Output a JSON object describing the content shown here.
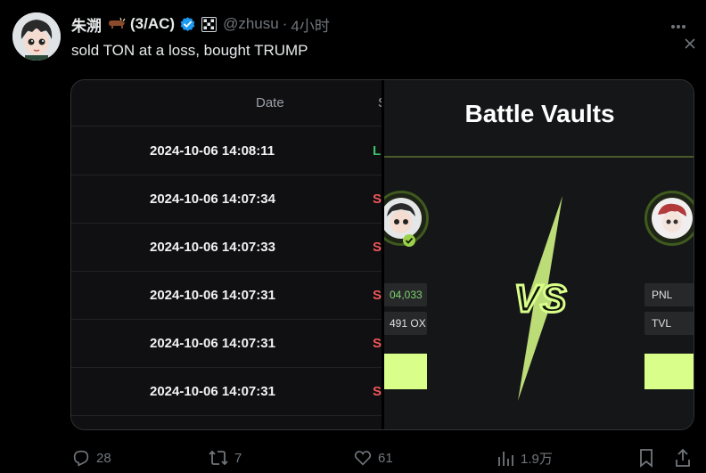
{
  "tweet": {
    "display_name": "朱溯",
    "name_suffix": "(3/AC)",
    "handle": "@zhusu",
    "dot": "·",
    "time": "4小时",
    "text": "sold TON at a loss, bought TRUMP"
  },
  "media": {
    "left": {
      "column_header": "Date",
      "column_header_2": "S",
      "rows": [
        {
          "date": "2024-10-06 14:08:11",
          "side": "L",
          "side_color": "#3fbf6a"
        },
        {
          "date": "2024-10-06 14:07:34",
          "side": "S",
          "side_color": "#f2555a"
        },
        {
          "date": "2024-10-06 14:07:33",
          "side": "S",
          "side_color": "#f2555a"
        },
        {
          "date": "2024-10-06 14:07:31",
          "side": "S",
          "side_color": "#f2555a"
        },
        {
          "date": "2024-10-06 14:07:31",
          "side": "S",
          "side_color": "#f2555a"
        },
        {
          "date": "2024-10-06 14:07:31",
          "side": "S",
          "side_color": "#f2555a"
        }
      ]
    },
    "right": {
      "title": "Battle Vaults",
      "left_pnl": "04,033",
      "left_tvl": "491 OX",
      "right_pnl_label": "PNL",
      "right_tvl_label": "TVL",
      "vs": "VS",
      "accent_color": "#d9ff8a"
    }
  },
  "actions": {
    "replies": "28",
    "reposts": "7",
    "likes": "61",
    "views": "1.9万"
  }
}
